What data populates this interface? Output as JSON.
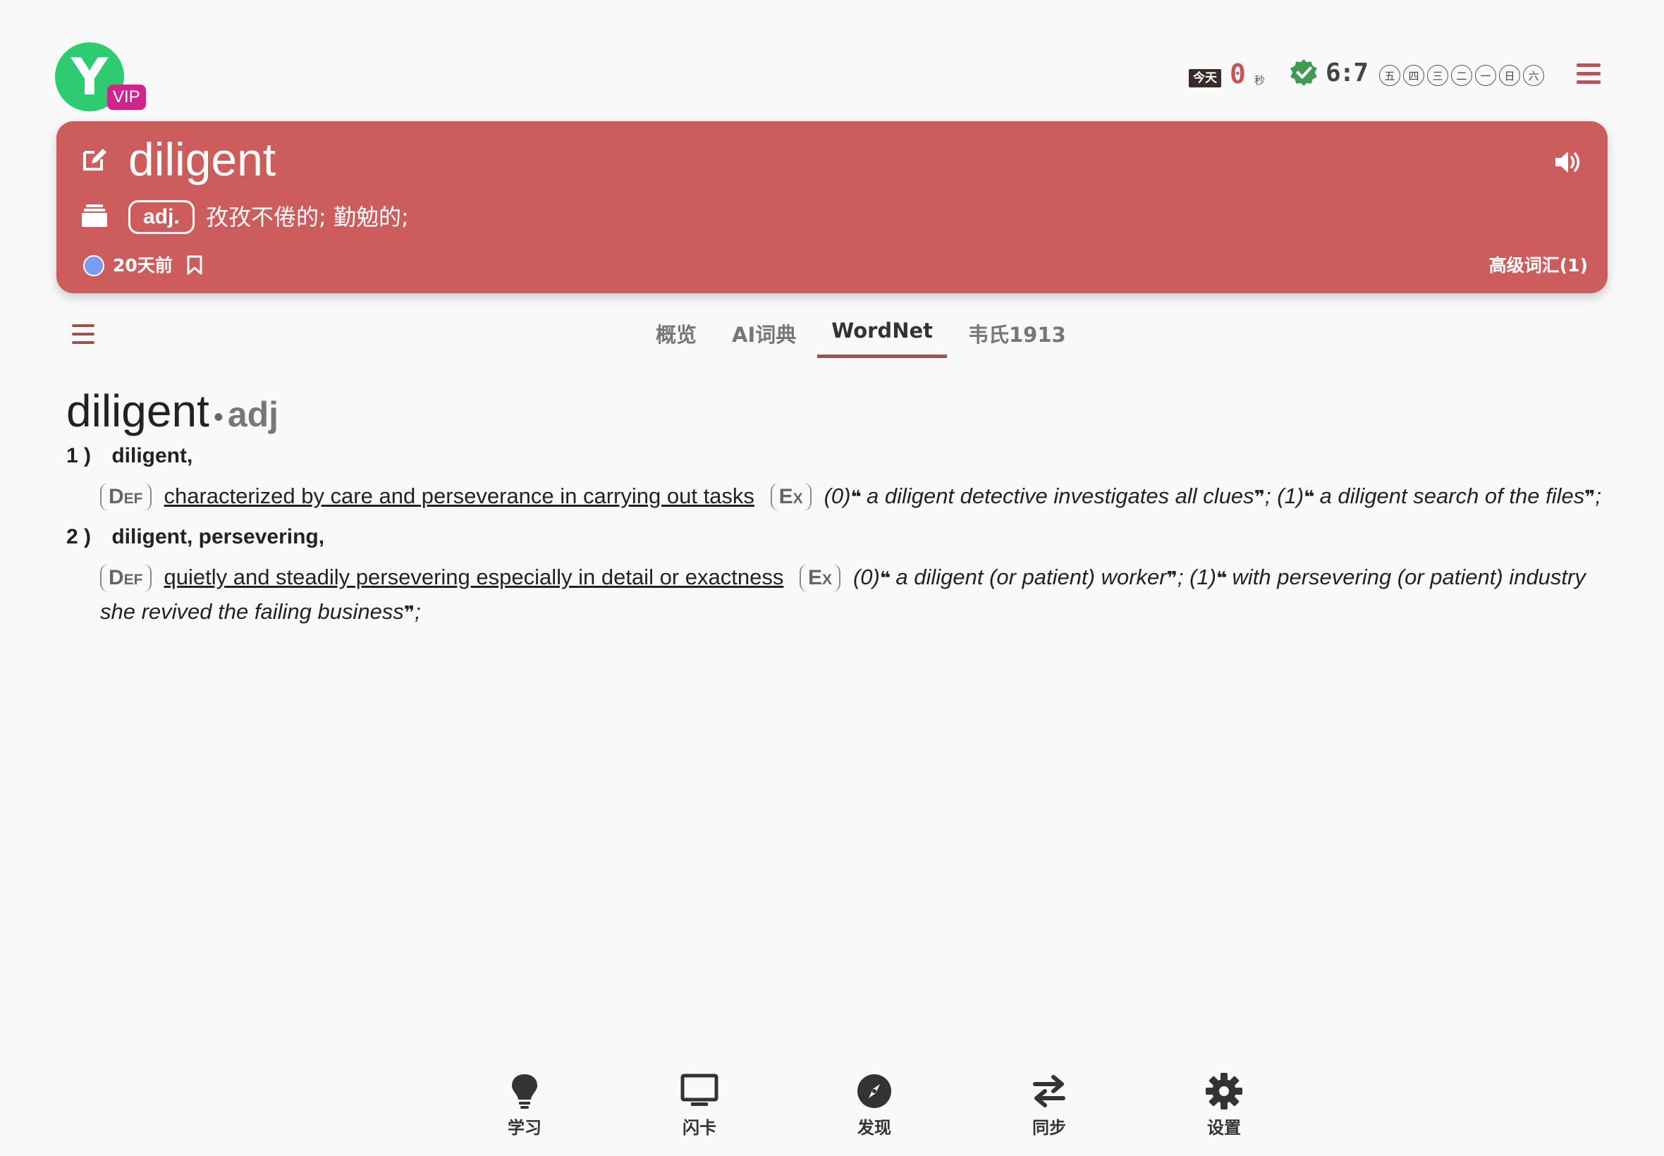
{
  "app": {
    "logo_letter": "Y",
    "vip": "VIP"
  },
  "header": {
    "today_label": "今天",
    "today_count": "0",
    "today_unit": "秒",
    "ratio": "6:7",
    "weekdays": [
      "五",
      "四",
      "三",
      "二",
      "一",
      "日",
      "六"
    ]
  },
  "card": {
    "word": "diligent",
    "pos": "adj.",
    "meaning": "孜孜不倦的; 勤勉的;",
    "added": "20天前",
    "tag": "高级词汇(1)",
    "accent_color": "#cd5c5c"
  },
  "tabs": [
    "概览",
    "AI词典",
    "WordNet",
    "韦氏1913"
  ],
  "active_tab": "WordNet",
  "entry": {
    "word": "diligent",
    "pos": "adj",
    "def_label": "Def",
    "ex_label": "Ex",
    "senses": [
      {
        "num": "1 )",
        "synonyms": "diligent,",
        "definition": "characterized by care and perseverance in carrying out tasks",
        "examples": [
          {
            "idx": "(0)",
            "text": "a diligent detective investigates all clues"
          },
          {
            "idx": "(1)",
            "text": "a diligent search of the files"
          }
        ]
      },
      {
        "num": "2 )",
        "synonyms": "diligent,  persevering,",
        "definition": "quietly and steadily persevering especially in detail or exactness",
        "examples": [
          {
            "idx": "(0)",
            "text": "a diligent (or patient) worker"
          },
          {
            "idx": "(1)",
            "text": "with persevering (or patient) industry she revived the failing business"
          }
        ]
      }
    ]
  },
  "bottom_nav": [
    {
      "label": "学习",
      "icon": "lightbulb-icon"
    },
    {
      "label": "闪卡",
      "icon": "monitor-icon"
    },
    {
      "label": "发现",
      "icon": "compass-icon"
    },
    {
      "label": "同步",
      "icon": "sync-arrows-icon"
    },
    {
      "label": "设置",
      "icon": "gear-icon"
    }
  ]
}
